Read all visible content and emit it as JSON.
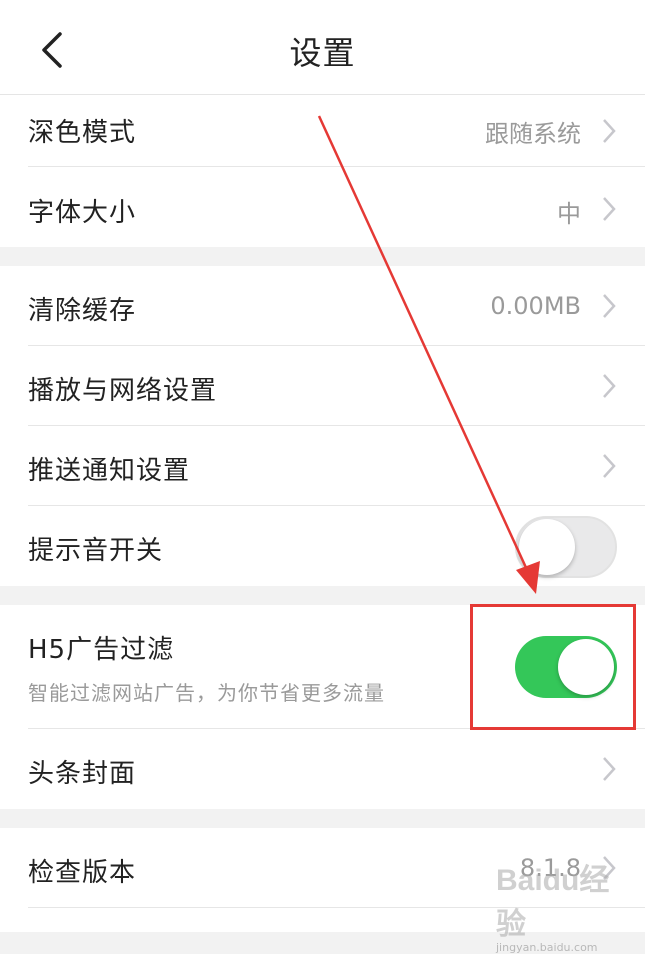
{
  "header": {
    "title": "设置",
    "back_icon": "chevron-left-icon"
  },
  "sections": {
    "display": [
      {
        "label": "深色模式",
        "value": "跟随系统"
      },
      {
        "label": "字体大小",
        "value": "中"
      }
    ],
    "general": [
      {
        "label": "清除缓存",
        "value": "0.00MB"
      },
      {
        "label": "播放与网络设置",
        "value": ""
      },
      {
        "label": "推送通知设置",
        "value": ""
      },
      {
        "label": "提示音开关",
        "toggle": "off"
      }
    ],
    "content": [
      {
        "label": "H5广告过滤",
        "sub": "智能过滤网站广告，为你节省更多流量",
        "toggle": "on"
      },
      {
        "label": "头条封面",
        "value": ""
      }
    ],
    "about": [
      {
        "label": "检查版本",
        "value": "8.1.8"
      }
    ]
  },
  "colors": {
    "toggle_on": "#34c759",
    "annotation": "#e53935",
    "secondary_text": "#9a9a9a"
  },
  "watermark": {
    "brand": "Baidu经验",
    "url": "jingyan.baidu.com"
  }
}
